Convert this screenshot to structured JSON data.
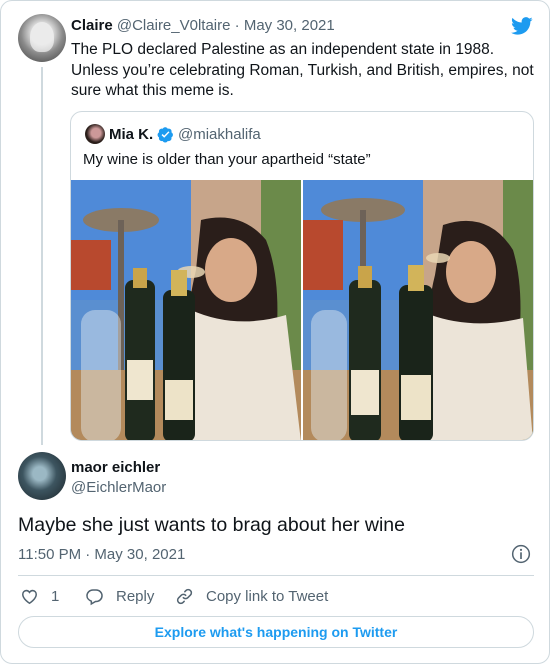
{
  "tweet": {
    "author_name": "Claire",
    "author_handle": "@Claire_V0ltaire",
    "separator": "·",
    "date": "May 30, 2021",
    "text": "The PLO declared Palestine as an independent state in 1988. Unless you’re celebrating Roman, Turkish, and British, empires, not sure what this meme is."
  },
  "quoted": {
    "author_name": "Mia K.",
    "author_handle": "@miakhalifa",
    "text": "My wine is older than your apartheid “state”"
  },
  "reply": {
    "author_name": "maor eichler",
    "author_handle": "@EichlerMaor",
    "text": "Maybe she just wants to brag about her wine",
    "timestamp": "11:50 PM · May 30, 2021"
  },
  "actions": {
    "like_count": "1",
    "reply_label": "Reply",
    "copy_label": "Copy link to Tweet"
  },
  "footer": {
    "explore_label": "Explore what's happening on Twitter"
  },
  "colors": {
    "twitter_blue": "#1d9bf0",
    "secondary_text": "#536471",
    "border": "#cfd9de"
  },
  "icons": [
    "twitter-logo-icon",
    "verified-badge-icon",
    "info-icon",
    "heart-icon",
    "reply-icon",
    "link-icon"
  ]
}
